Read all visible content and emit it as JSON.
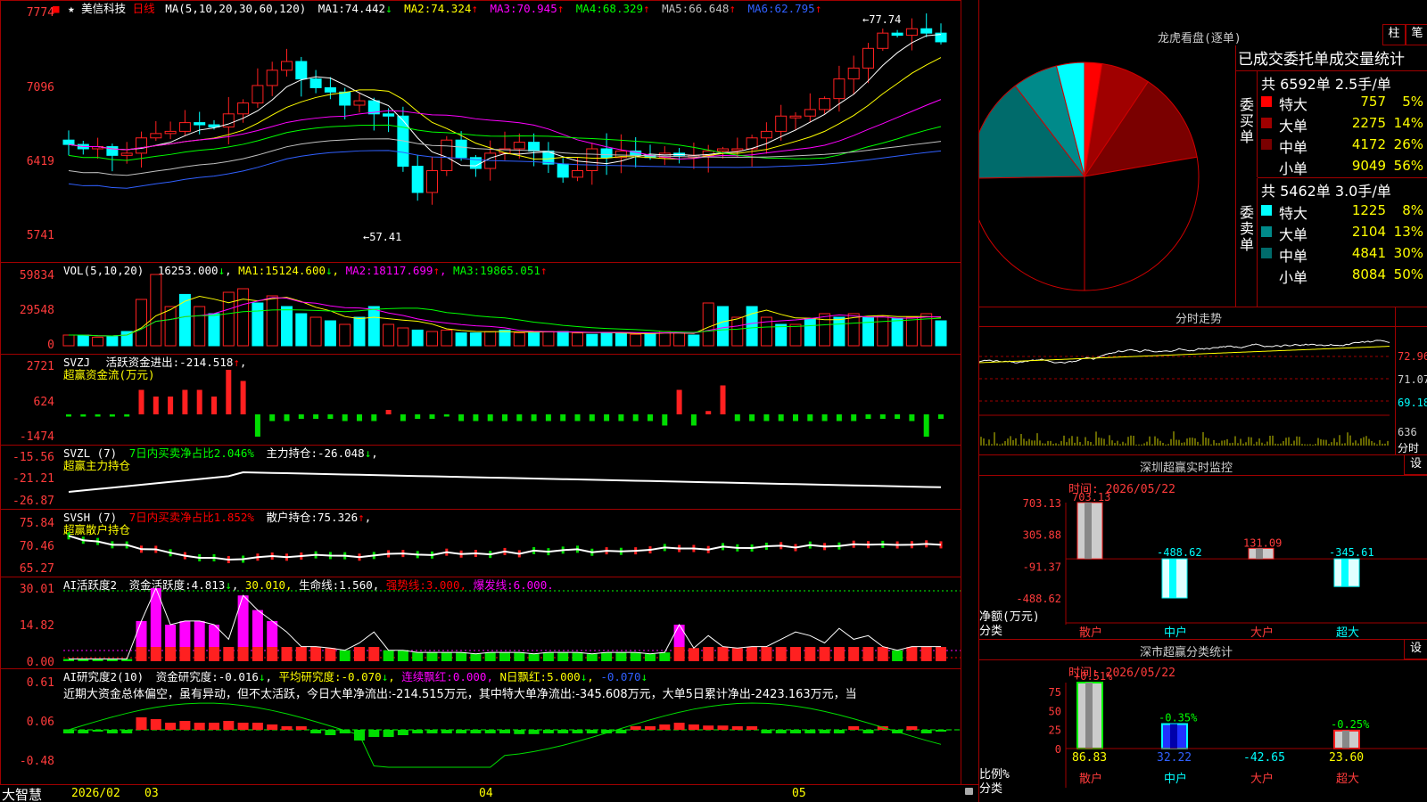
{
  "stock": {
    "name": "美信科技",
    "period": "日线",
    "star": "★",
    "box_icon": "■"
  },
  "kline": {
    "ma_params": "MA(5,10,20,30,60,120)",
    "ma_values": [
      {
        "label": "MA1:",
        "value": "74.442",
        "arrow": "↓",
        "color": "#ffffff"
      },
      {
        "label": "MA2:",
        "value": "74.324",
        "arrow": "↑",
        "color": "#ffff00"
      },
      {
        "label": "MA3:",
        "value": "70.945",
        "arrow": "↑",
        "color": "#ff00ff"
      },
      {
        "label": "MA4:",
        "value": "68.329",
        "arrow": "↑",
        "color": "#00ff00"
      },
      {
        "label": "MA5:",
        "value": "66.648",
        "arrow": "↑",
        "color": "#c0c0c0"
      },
      {
        "label": "MA6:",
        "value": "62.795",
        "arrow": "↑",
        "color": "#3060ff"
      }
    ],
    "y_ticks": [
      "7774",
      "7096",
      "6419",
      "5741"
    ],
    "high_mark": "77.74",
    "low_mark": "57.41"
  },
  "vol": {
    "header": "VOL(5,10,20)",
    "current": "16253.000",
    "current_arrow": "↓",
    "ma": [
      {
        "label": "MA1:",
        "value": "15124.600",
        "arrow": "↓",
        "color": "#ffff00"
      },
      {
        "label": "MA2:",
        "value": "18117.699",
        "arrow": "↑",
        "color": "#ff00ff"
      },
      {
        "label": "MA3:",
        "value": "19865.051",
        "arrow": "↑",
        "color": "#00ff00"
      }
    ],
    "y_ticks": [
      "59834",
      "29548",
      "0"
    ]
  },
  "svzj": {
    "header": "SVZJ",
    "label": "活跃资金进出:",
    "value": "-214.518",
    "arrow": "↑",
    "subtitle": "超赢资金流(万元)",
    "y_ticks": [
      "2721",
      "624",
      "-1474"
    ]
  },
  "svzl": {
    "header": "SVZL (7)",
    "ratio_label": "7日内买卖净占比2.046%",
    "hold_label": "主力持仓:",
    "hold_value": "-26.048",
    "arrow": "↓",
    "subtitle": "超赢主力持仓",
    "y_ticks": [
      "-15.56",
      "-21.21",
      "-26.87"
    ]
  },
  "svsh": {
    "header": "SVSH (7)",
    "ratio_label": "7日内买卖净占比1.852%",
    "hold_label": "散户持仓:",
    "hold_value": "75.326",
    "arrow": "↑",
    "subtitle": "超赢散户持仓",
    "y_ticks": [
      "75.84",
      "70.46",
      "65.27"
    ]
  },
  "ai_active": {
    "header": "AI活跃度2",
    "label": "资金活跃度:",
    "value": "4.813",
    "arrow": "↓",
    "v2": "30.010",
    "life_label": "生命线:",
    "life_value": "1.560",
    "strong_label": "强势线:",
    "strong_value": "3.000",
    "burst_label": "爆发线:",
    "burst_value": "6.000",
    "y_ticks": [
      "30.01",
      "14.82",
      "0.00"
    ]
  },
  "ai_research": {
    "header": "AI研究度2(10)",
    "label": "资金研究度:",
    "value": "-0.016",
    "arrow": "↓",
    "avg_label": "平均研究度:",
    "avg_value": "-0.070",
    "avg_arrow": "↓",
    "red_label": "连续飘红:",
    "red_value": "0.000",
    "n_label": "N日飘红:",
    "n_value": "5.000",
    "n_arrow": "↓",
    "last_value": "-0.070",
    "last_arrow": "↓",
    "comment": "近期大资金总体偏空，虽有异动，但不太活跃，今日大单净流出:-214.515万元，其中特大单净流出:-345.608万元，大单5日累计净出-2423.163万元，当",
    "y_ticks": [
      "0.61",
      "0.06",
      "-0.48"
    ]
  },
  "date_axis": {
    "labels": [
      "2026/02",
      "03",
      "04",
      "05"
    ]
  },
  "brand": "大智慧",
  "lhkp": {
    "title": "龙虎看盘(逐单)",
    "btn_bar": "柱",
    "btn_pen": "笔",
    "stat_title": "已成交委托单成交量统计",
    "buy": {
      "side_label": "委买单",
      "summary": "共 6592单 2.5手/单",
      "rows": [
        {
          "name": "特大",
          "value": "757",
          "pct": "5%",
          "color": "#ff0000"
        },
        {
          "name": "大单",
          "value": "2275",
          "pct": "14%",
          "color": "#a00000"
        },
        {
          "name": "中单",
          "value": "4172",
          "pct": "26%",
          "color": "#7a0000"
        },
        {
          "name": "小单",
          "value": "9049",
          "pct": "56%",
          "color": "#000000"
        }
      ]
    },
    "sell": {
      "side_label": "委卖单",
      "summary": "共 5462单 3.0手/单",
      "rows": [
        {
          "name": "特大",
          "value": "1225",
          "pct": "8%",
          "color": "#00ffff"
        },
        {
          "name": "大单",
          "value": "2104",
          "pct": "13%",
          "color": "#008a8a"
        },
        {
          "name": "中单",
          "value": "4841",
          "pct": "30%",
          "color": "#006b6b"
        },
        {
          "name": "小单",
          "value": "8084",
          "pct": "50%",
          "color": "#000000"
        }
      ]
    },
    "pie": [
      {
        "label": "buy-特大",
        "value": 5,
        "color": "#ff0000"
      },
      {
        "label": "buy-大单",
        "value": 14,
        "color": "#a00000"
      },
      {
        "label": "buy-中单",
        "value": 26,
        "color": "#7a0000"
      },
      {
        "label": "buy-小单",
        "value": 56,
        "color": "#000000"
      },
      {
        "label": "sell-小单",
        "value": 50,
        "color": "#000000"
      },
      {
        "label": "sell-中单",
        "value": 30,
        "color": "#006b6b"
      },
      {
        "label": "sell-大单",
        "value": 13,
        "color": "#008a8a"
      },
      {
        "label": "sell-特大",
        "value": 8,
        "color": "#00ffff"
      }
    ]
  },
  "intraday": {
    "title": "分时走势",
    "y_ticks": [
      "72.96",
      "71.07",
      "69.18"
    ],
    "vol_ticks": [
      "636",
      "分时"
    ]
  },
  "sz_monitor": {
    "title": "深圳超赢实时监控",
    "settings": "设",
    "time": "时间: 2026/05/22",
    "y_ticks": [
      "703.13",
      "305.88",
      "-91.37",
      "-488.62"
    ],
    "ylabel": "净额(万元)",
    "xlabel": "分类",
    "categories": [
      "散户",
      "中户",
      "大户",
      "超大"
    ],
    "values": [
      703.13,
      -488.62,
      131.09,
      -345.61
    ],
    "labels": [
      "703.13",
      "-488.62",
      "131.09",
      "-345.61"
    ]
  },
  "sz_class": {
    "title": "深市超赢分类统计",
    "settings": "设",
    "time": "时间: 2026/05/22",
    "y_ticks": [
      "75",
      "50",
      "25",
      "0"
    ],
    "ylabel": "比例%",
    "xlabel": "分类",
    "categories": [
      "散户",
      "中户",
      "大户",
      "超大"
    ],
    "bar_values": [
      86.83,
      32.22,
      -42.65,
      23.6
    ],
    "bar_labels": [
      "86.83",
      "32.22",
      "-42.65",
      "23.60"
    ],
    "top_labels": [
      "+0.51%",
      "-0.35%",
      "",
      "-0.25%"
    ]
  },
  "chart_data": [
    {
      "type": "bar",
      "title": "深圳超赢实时监控",
      "categories": [
        "散户",
        "中户",
        "大户",
        "超大"
      ],
      "values": [
        703.13,
        -488.62,
        131.09,
        -345.61
      ],
      "ylabel": "净额(万元)",
      "ylim": [
        -488.62,
        703.13
      ]
    },
    {
      "type": "bar",
      "title": "深市超赢分类统计",
      "categories": [
        "散户",
        "中户",
        "大户",
        "超大"
      ],
      "values": [
        86.83,
        32.22,
        -42.65,
        23.6
      ],
      "ylabel": "比例%",
      "ylim": [
        0,
        86.83
      ]
    },
    {
      "type": "pie",
      "title": "龙虎看盘(逐单)",
      "categories": [
        "委买特大",
        "委买大单",
        "委买中单",
        "委买小单",
        "委卖小单",
        "委卖中单",
        "委卖大单",
        "委卖特大"
      ],
      "values": [
        5,
        14,
        26,
        56,
        50,
        30,
        13,
        8
      ]
    }
  ]
}
